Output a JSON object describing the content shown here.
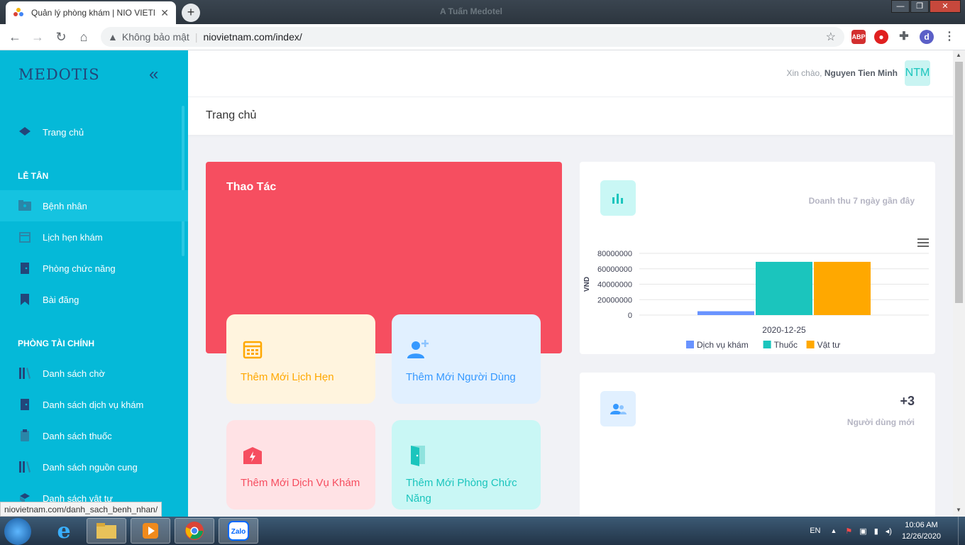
{
  "browser": {
    "tab_title": "Quản lý phòng khám | NIO VIETNAM",
    "window_title": "A Tuấn Medotel",
    "security_label": "Không bảo mật",
    "url": "niovietnam.com/index/",
    "profile_initial": "d",
    "status_url": "niovietnam.com/danh_sach_benh_nhan/",
    "ext_abp": "ABP"
  },
  "sidebar": {
    "logo": "MEDOTIS",
    "home": "Trang chủ",
    "section1": "LỄ TÂN",
    "section1_items": [
      {
        "label": "Bệnh nhân",
        "icon": "patient-folder-icon"
      },
      {
        "label": "Lịch hẹn khám",
        "icon": "calendar-icon"
      },
      {
        "label": "Phòng chức năng",
        "icon": "door-icon"
      },
      {
        "label": "Bài đăng",
        "icon": "bookmark-icon"
      }
    ],
    "section2": "PHÒNG TÀI CHÍNH",
    "section2_items": [
      {
        "label": "Danh sách chờ",
        "icon": "books-icon"
      },
      {
        "label": "Danh sách dịch vụ khám",
        "icon": "door-icon"
      },
      {
        "label": "Danh sách thuốc",
        "icon": "clipboard-icon"
      },
      {
        "label": "Danh sách nguồn cung",
        "icon": "books-icon"
      },
      {
        "label": "Danh sách vật tư",
        "icon": "box-icon"
      }
    ]
  },
  "header": {
    "greeting": "Xin chào,",
    "user_name": "Nguyen Tien Minh",
    "avatar_initials": "NTM",
    "page_title": "Trang chủ"
  },
  "actions": {
    "title": "Thao Tác",
    "items": [
      {
        "label": "Thêm Mới Lịch Hẹn",
        "color": "#ffa800"
      },
      {
        "label": "Thêm Mới Người Dùng",
        "color": "#3699ff"
      },
      {
        "label": "Thêm Mới Dịch Vụ Khám",
        "color": "#f64e60"
      },
      {
        "label": "Thêm Mới Phòng Chức Năng",
        "color": "#1bc5bd"
      }
    ]
  },
  "revenue_card": {
    "subtitle": "Doanh thu 7 ngày gần đây"
  },
  "chart_data": {
    "type": "bar",
    "categories": [
      "2020-12-25"
    ],
    "series": [
      {
        "name": "Dịch vụ khám",
        "values": [
          5000000
        ],
        "color": "#6993ff"
      },
      {
        "name": "Thuốc",
        "values": [
          69000000
        ],
        "color": "#1bc5bd"
      },
      {
        "name": "Vật tư",
        "values": [
          69000000
        ],
        "color": "#ffa800"
      }
    ],
    "ylabel": "VND",
    "yticks": [
      "0",
      "20000000",
      "40000000",
      "60000000",
      "80000000"
    ],
    "ylim": [
      0,
      80000000
    ],
    "grid": true,
    "legend": "bottom"
  },
  "users_card": {
    "count": "+3",
    "subtitle": "Người dùng mới"
  },
  "taskbar": {
    "lang": "EN",
    "time": "10:06 AM",
    "date": "12/26/2020",
    "zalo": "Zalo"
  }
}
